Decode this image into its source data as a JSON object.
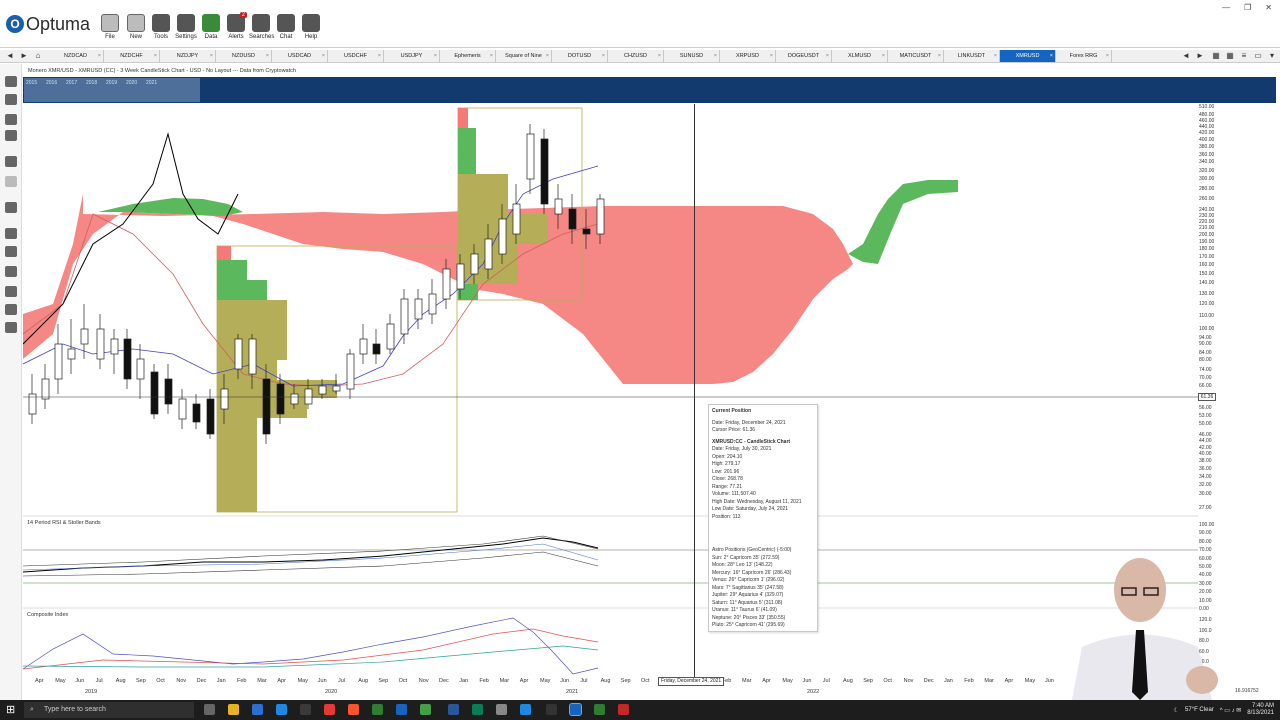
{
  "ribbon": {
    "logo": "Optuma",
    "tools": [
      {
        "label": "File",
        "icon": "folder-icon"
      },
      {
        "label": "New",
        "icon": "new-doc-icon"
      },
      {
        "label": "Tools",
        "icon": "tools-icon"
      },
      {
        "label": "Settings",
        "icon": "gear-icon"
      },
      {
        "label": "Data",
        "icon": "data-icon"
      },
      {
        "label": "Alerts",
        "icon": "alarm-clock-icon",
        "badge": "2"
      },
      {
        "label": "Searches",
        "icon": "magnifier-icon"
      },
      {
        "label": "Chat",
        "icon": "chat-icon"
      },
      {
        "label": "Help",
        "icon": "help-icon"
      }
    ],
    "window_controls": [
      "—",
      "❐",
      "✕"
    ]
  },
  "tabs": [
    "NZDCAD",
    "NZDCHF",
    "NZDJPY",
    "NZDUSD",
    "USDCAD",
    "USDCHF",
    "USDJPY",
    "Ephemeris",
    "Square of Nine",
    "DOTUSD",
    "CHZUSD",
    "SUNUSD",
    "XRPUSD",
    "DOGEUSDT",
    "XLMUSD",
    "MATICUSDT",
    "LINKUSDT",
    "XMRUSD",
    "Forex RRG"
  ],
  "active_tab": "XMRUSD",
  "chart_title": "Monero XMR/USD - XMRUSD (CC) - 3 Week CandleStick Chart - USD - No Layout --- Data from Cryptowatch",
  "timeline_years": [
    "2015",
    "2016",
    "2017",
    "2018",
    "2019",
    "2020",
    "2021"
  ],
  "price_axis": [
    "510.00",
    "480.00",
    "460.00",
    "440.00",
    "420.00",
    "400.00",
    "380.00",
    "360.00",
    "340.00",
    "320.00",
    "300.00",
    "280.00",
    "260.00",
    "240.00",
    "230.00",
    "220.00",
    "210.00",
    "200.00",
    "190.00",
    "180.00",
    "170.00",
    "160.00",
    "150.00",
    "140.00",
    "130.00",
    "120.00",
    "110.00",
    "100.00",
    "94.00",
    "90.00",
    "84.00",
    "80.00",
    "74.00",
    "70.00",
    "66.00",
    "61.36",
    "56.00",
    "53.00",
    "50.00",
    "46.00",
    "44.00",
    "42.00",
    "40.00",
    "38.00",
    "36.00",
    "34.00",
    "32.00",
    "30.00",
    "27.00"
  ],
  "cursor_price": "61.36",
  "rsi_panel": {
    "label": "14 Period RSI & Stoller Bands",
    "axis": [
      "100.00",
      "90.00",
      "80.00",
      "70.00",
      "60.00",
      "50.00",
      "40.00",
      "30.00",
      "20.00",
      "10.00",
      "0.00"
    ]
  },
  "composite_panel": {
    "label": "Composite Index",
    "axis": [
      "120.0",
      "100.0",
      "80.0",
      "60.0",
      "40.0",
      "20.0"
    ]
  },
  "date_axis": {
    "months": [
      "Apr",
      "May",
      "Jun",
      "Jul",
      "Aug",
      "Sep",
      "Oct",
      "Nov",
      "Dec",
      "Jan",
      "Feb",
      "Mar",
      "Apr",
      "May",
      "Jun",
      "Jul",
      "Aug",
      "Sep",
      "Oct",
      "Nov",
      "Dec",
      "Jan",
      "Feb",
      "Mar",
      "Apr",
      "May",
      "Jun",
      "Jul",
      "Aug",
      "Sep",
      "Oct",
      "Nov",
      "Dec",
      "Jan",
      "Feb",
      "Mar",
      "Apr",
      "May",
      "Jun",
      "Jul",
      "Aug",
      "Sep",
      "Oct",
      "Nov",
      "Dec",
      "Jan",
      "Feb",
      "Mar",
      "Apr",
      "May",
      "Jun"
    ],
    "years": [
      "2019",
      "2020",
      "2021",
      "2022"
    ],
    "cursor_date": "Friday, December 24, 2021"
  },
  "tooltip": {
    "title": "Current Position",
    "date": "Date: Friday, December 24, 2021",
    "cursor": "Cursor Price: 61.36",
    "chart_header": "XMRUSD:CC - CandleStick Chart",
    "lines": [
      "Date: Friday, July 30, 2021",
      "Open: 204.10",
      "High: 279.17",
      "Low: 201.96",
      "Close: 268.78",
      "Range: 77.21",
      "Volume: 111,507.40",
      "High Date: Wednesday, August 11, 2021",
      "Low Date: Saturday, July 24, 2021",
      "Position: 113"
    ],
    "astro_header": "Astro Positions (GeoCentric) (-5:00)",
    "astro": [
      "Sun: 2° Capricorn 35' (272.59)",
      "Moon: 28° Leo 13' (148.22)",
      "Mercury: 16° Capricorn 26' (286.43)",
      "Venus: 26° Capricorn 1' (296.02)",
      "Mars: 7° Sagittarius 35' (247.58)",
      "Jupiter: 29° Aquarius 4' (329.07)",
      "Saturn: 11° Aquarius 5' (311.08)",
      "Uranus: 11° Taurus 6' (41.09)",
      "Neptune: 20° Pisces 33' (350.55)",
      "Pluto: 25° Capricorn 41' (295.69)"
    ]
  },
  "zoom": "16.916752",
  "taskbar": {
    "search_placeholder": "Type here to search",
    "weather": "57°F  Clear",
    "time": "7:40 AM",
    "date": "8/13/2021"
  },
  "colors": {
    "tab_active": "#1565c0",
    "cloud_bear": "#f47a78",
    "cloud_bull": "#5cb85c",
    "volume_profile": "#b5ae58",
    "timebar": "#123a6e"
  }
}
